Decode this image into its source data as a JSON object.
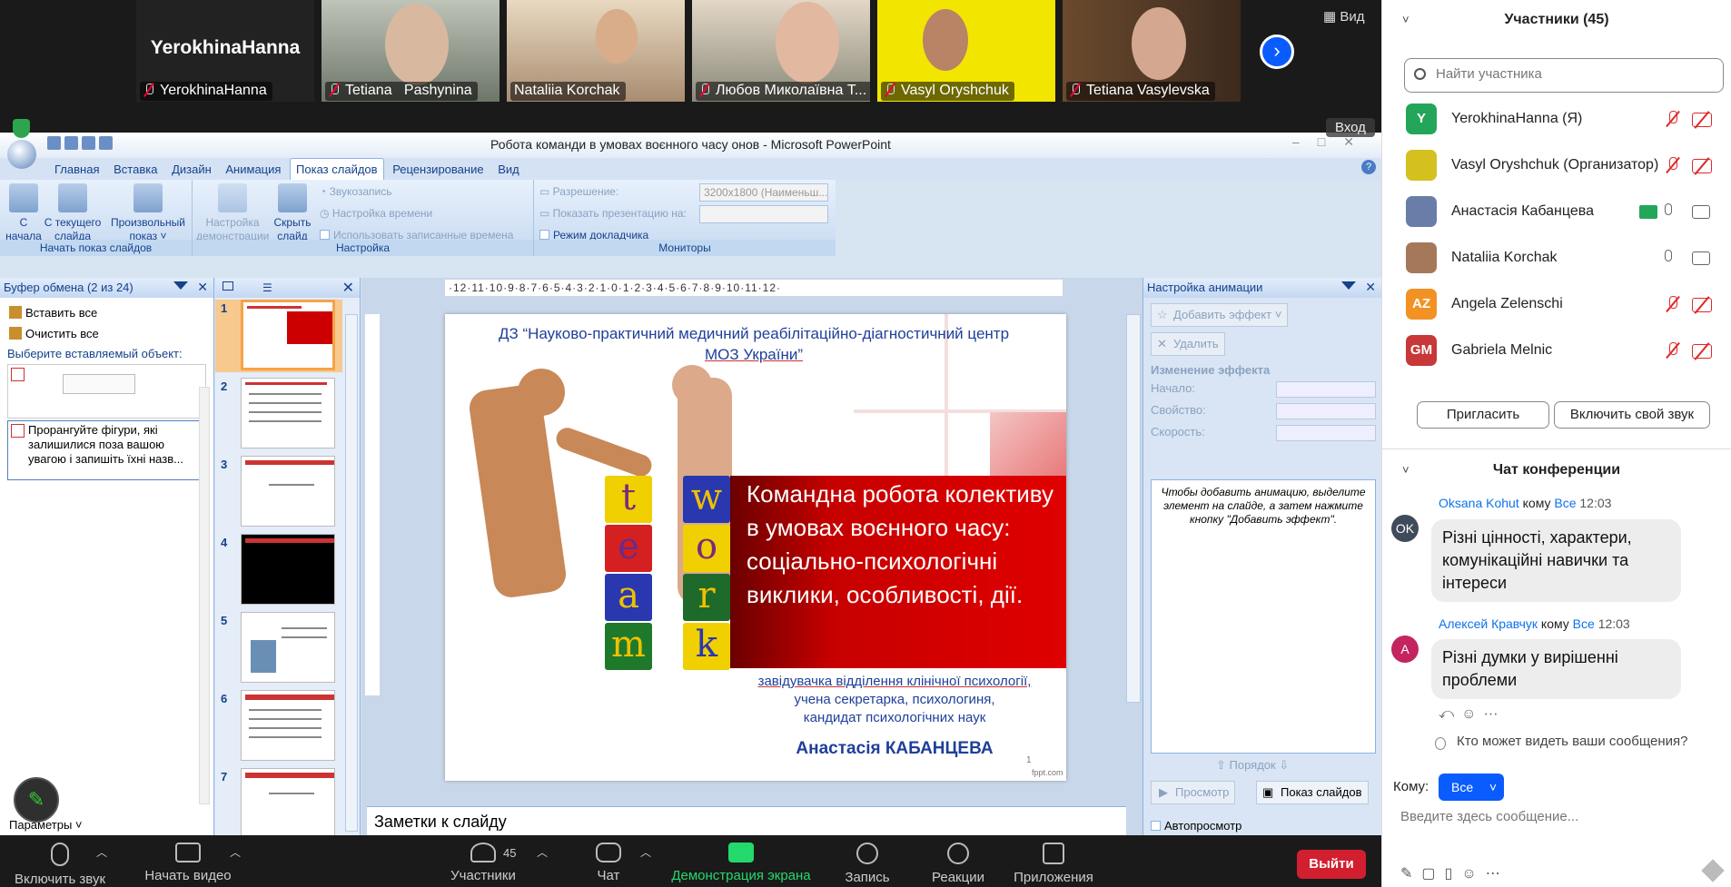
{
  "video_strip": {
    "tiles": [
      {
        "name": "YerokhinaHanna",
        "big": "YerokhinaHanna",
        "muted": true
      },
      {
        "name": "Tetiana   Pashynina",
        "muted": true
      },
      {
        "name": "Nataliia Korchak",
        "muted": false
      },
      {
        "name": "Любов Миколаївна Т...",
        "muted": true
      },
      {
        "name": "Vasyl Oryshchuk",
        "muted": true
      },
      {
        "name": "Tetiana Vasylevska",
        "muted": true
      }
    ],
    "view_label": "Вид",
    "enter_label": "Вход"
  },
  "ppt": {
    "title": "Робота команди в умовах воєнного часу онов - Microsoft PowerPoint",
    "tabs": [
      "Главная",
      "Вставка",
      "Дизайн",
      "Анимация",
      "Показ слайдов",
      "Рецензирование",
      "Вид"
    ],
    "active_tab": "Показ слайдов",
    "ribbon": {
      "group_start": "Начать показ слайдов",
      "btn_from_start": [
        "С",
        "начала"
      ],
      "btn_from_current": [
        "С текущего",
        "слайда"
      ],
      "btn_custom": [
        "Произвольный",
        "показ ˅"
      ],
      "group_setup": "Настройка",
      "btn_setup": [
        "Настройка",
        "демонстрации"
      ],
      "btn_hide": [
        "Скрыть",
        "слайд"
      ],
      "sound": "Звукозапись",
      "timing": "Настройка времени",
      "use_timings": "Использовать записанные времена",
      "group_monitors": "Мониторы",
      "resolution_label": "Разрешение:",
      "resolution_value": "3200x1800 (Наименьш...",
      "show_on_label": "Показать презентацию на:",
      "presenter_mode": "Режим докладчика"
    },
    "clipboard": {
      "title": "Буфер обмена (2 из 24)",
      "paste_all": "Вставить все",
      "clear_all": "Очистить все",
      "select_prompt": "Выберите вставляемый объект:",
      "item2_text": "Прорангуйте фігури, які залишилися поза вашою увагою і запишіть їхні назв...",
      "params": "Параметры ˅"
    },
    "slide_numbers": [
      "1",
      "2",
      "3",
      "4",
      "5",
      "6",
      "7"
    ],
    "ruler_text": "·12·11·10·9·8·7·6·5·4·3·2·1·0·1·2·3·4·5·6·7·8·9·10·11·12·",
    "slide": {
      "org_line1": "ДЗ “Науково-практичний медичний реабілітаційно-діагностичний центр",
      "org_line2": "МОЗ України”",
      "title": "Командна робота колективу в умовах воєнного часу: соціально-психологічні виклики, особливості, дії.",
      "blocks_team": [
        "t",
        "e",
        "a",
        "m"
      ],
      "blocks_work": [
        "w",
        "o",
        "r",
        "k"
      ],
      "sub_line1": "завідувачка відділення клінічної психології,",
      "sub_line2": "учена секретарка,  психологиня,",
      "sub_line3": "кандидат психологічних наук",
      "author": "Анастасія КАБАНЦЕВА",
      "page": "1",
      "brand": "fppt.com"
    },
    "notes_placeholder": "Заметки к слайду",
    "animation": {
      "title": "Настройка анимации",
      "add_effect": "Добавить эффект ˅",
      "remove": "Удалить",
      "change_effect": "Изменение эффекта",
      "start": "Начало:",
      "property": "Свойство:",
      "speed": "Скорость:",
      "hint": "Чтобы добавить анимацию, выделите элемент на слайде, а затем нажмите кнопку \"Добавить эффект\".",
      "order": "Порядок",
      "preview": "Просмотр",
      "slideshow": "Показ слайдов",
      "autopreview": "Автопросмотр"
    }
  },
  "toolbar": {
    "audio": "Включить звук",
    "video": "Начать видео",
    "participants": "Участники",
    "participants_count": "45",
    "chat": "Чат",
    "share": "Демонстрация экрана",
    "record": "Запись",
    "reactions": "Реакции",
    "apps": "Приложения",
    "leave": "Выйти"
  },
  "sidebar": {
    "participants_title": "Участники (45)",
    "search_placeholder": "Найти участника",
    "participants": [
      {
        "initials": "Y",
        "name": "YerokhinaHanna (Я)",
        "color": "#23a55a",
        "mic": "muted",
        "cam": "muted"
      },
      {
        "initials": "",
        "name": "Vasyl Oryshchuk (Организатор)",
        "color": "#d4c01e",
        "mic": "muted",
        "cam": "muted"
      },
      {
        "initials": "",
        "name": "Анастасія Кабанцева",
        "color": "#6a7da8",
        "mic": "on",
        "cam": "on",
        "sharing": true
      },
      {
        "initials": "",
        "name": "Nataliia Korchak",
        "color": "#a6785a",
        "mic": "on",
        "cam": "on"
      },
      {
        "initials": "AZ",
        "name": "Angela Zelenschi",
        "color": "#f29225",
        "mic": "muted",
        "cam": "muted"
      },
      {
        "initials": "GM",
        "name": "Gabriela Melnic",
        "color": "#c83838",
        "mic": "muted",
        "cam": "muted"
      }
    ],
    "invite": "Пригласить",
    "unmute": "Включить свой звук",
    "chat_title": "Чат конференции",
    "messages": [
      {
        "initials": "OK",
        "author": "Oksana Kohut",
        "to_word": "кому",
        "to": "Все",
        "time": "12:03",
        "text": "Різні цінності, характери, комунікаційні навички та інтереси",
        "color": "#3f4a5a"
      },
      {
        "initials": "A",
        "author": "Алексей Кравчук",
        "to_word": "кому",
        "to": "Все",
        "time": "12:03",
        "text": "Різні думки у вирішенні проблеми",
        "color": "#c4245f"
      }
    ],
    "who_can_see": "Кто может видеть ваши сообщения?",
    "to_label": "Кому:",
    "to_value": "Все",
    "input_placeholder": "Введите здесь сообщение..."
  }
}
